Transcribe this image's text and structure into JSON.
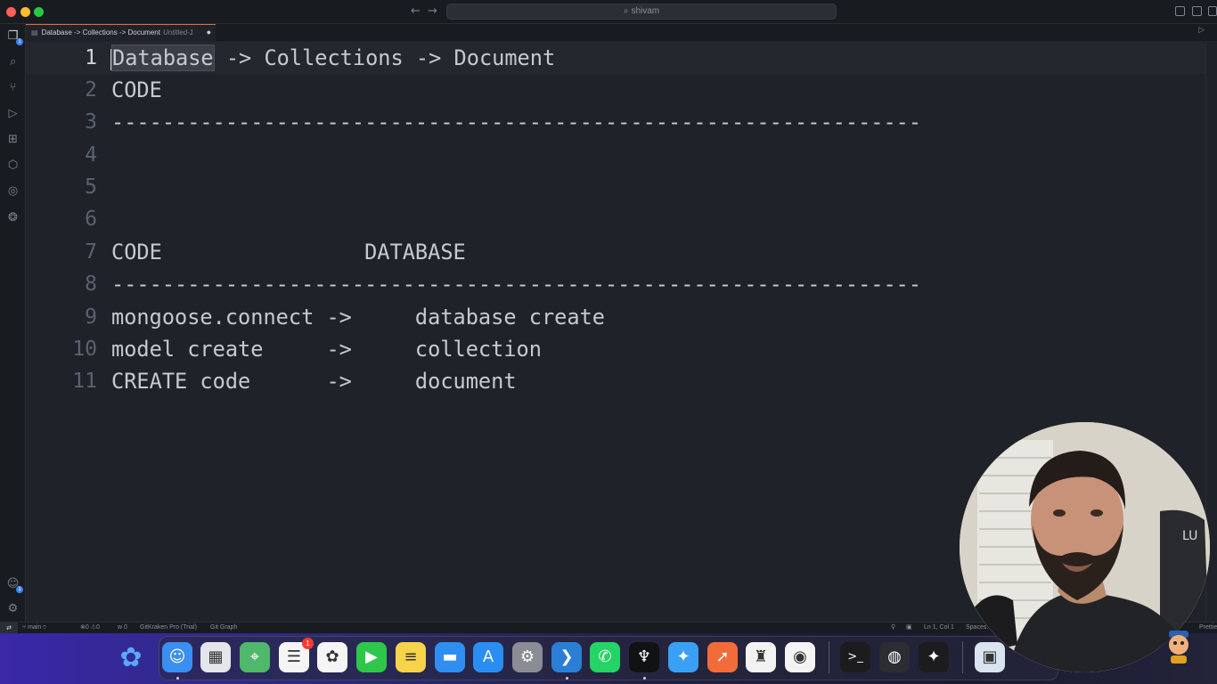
{
  "window": {
    "search_text": "shivam",
    "search_icon": "search-icon",
    "nav_back_icon": "arrow-left-icon",
    "nav_forward_icon": "arrow-right-icon"
  },
  "activity_bar": {
    "items": [
      "files-icon",
      "search-icon",
      "source-control-icon",
      "run-debug-icon",
      "extensions-icon",
      "remote-explorer-icon",
      "gitlens-icon",
      "gitkraken-icon"
    ],
    "bottom": [
      "accounts-icon",
      "settings-gear-icon"
    ],
    "badge": "1"
  },
  "tab": {
    "title": "Database -> Collections -> Document",
    "description": "Untitled-1",
    "modified_indicator": "●"
  },
  "editor": {
    "lines": [
      {
        "number": "1",
        "selected": "Database",
        "text": " -> Collections -> Document"
      },
      {
        "number": "2",
        "text": "CODE"
      },
      {
        "number": "3",
        "text": "----------------------------------------------------------------"
      },
      {
        "number": "4",
        "text": ""
      },
      {
        "number": "5",
        "text": ""
      },
      {
        "number": "6",
        "text": ""
      },
      {
        "number": "7",
        "text": "CODE                DATABASE"
      },
      {
        "number": "8",
        "text": "----------------------------------------------------------------"
      },
      {
        "number": "9",
        "text": "mongoose.connect ->     database create"
      },
      {
        "number": "10",
        "text": "model create     ->     collection"
      },
      {
        "number": "11",
        "text": "CREATE code      ->     document"
      }
    ]
  },
  "status_bar": {
    "branch": "main",
    "problems": "0",
    "warnings": "0",
    "ports": "0",
    "gitkraken": "GitKraken Pro (Trial)",
    "git_graph": "Git Graph",
    "position": "Ln 1, Col 1",
    "spaces": "Spaces:",
    "prettier": "Prettie"
  },
  "dock": {
    "apps": [
      {
        "name": "finder-icon",
        "glyph": "☺",
        "color": "#3b8ff0"
      },
      {
        "name": "launchpad-icon",
        "glyph": "▦",
        "color": "#e4e6eb"
      },
      {
        "name": "maps-icon",
        "glyph": "⌖",
        "color": "#4fb86b"
      },
      {
        "name": "reminders-icon",
        "glyph": "☰",
        "color": "#f5f5f5",
        "badge": "1"
      },
      {
        "name": "photos-icon",
        "glyph": "✿",
        "color": "#f5f5f5"
      },
      {
        "name": "facetime-icon",
        "glyph": "▶",
        "color": "#2fc74b"
      },
      {
        "name": "notes-icon",
        "glyph": "≡",
        "color": "#f7d34a"
      },
      {
        "name": "keynote-icon",
        "glyph": "▬",
        "color": "#2f8ef0"
      },
      {
        "name": "app-store-icon",
        "glyph": "A",
        "color": "#2b8df2"
      },
      {
        "name": "system-settings-icon",
        "glyph": "⚙",
        "color": "#8a8d93"
      },
      {
        "name": "vscode-icon",
        "glyph": "❯",
        "color": "#2a7fd4"
      },
      {
        "name": "whatsapp-icon",
        "glyph": "✆",
        "color": "#25d366"
      },
      {
        "name": "gitkraken-app-icon",
        "glyph": "♆",
        "color": "#111214"
      },
      {
        "name": "safari-icon",
        "glyph": "✦",
        "color": "#3aa0f5"
      },
      {
        "name": "postman-icon",
        "glyph": "➚",
        "color": "#f26b3a"
      },
      {
        "name": "brave-icon",
        "glyph": "♜",
        "color": "#f2f2f2"
      },
      {
        "name": "chrome-icon",
        "glyph": "◉",
        "color": "#f4f4f4"
      },
      {
        "name": "terminal-icon",
        "glyph": ">_",
        "color": "#1c1c1e"
      },
      {
        "name": "obs-icon",
        "glyph": "◍",
        "color": "#2b2d33"
      },
      {
        "name": "figma-icon",
        "glyph": "✦",
        "color": "#1c1c1e"
      },
      {
        "name": "preview-icon",
        "glyph": "▣",
        "color": "#d9e4f0"
      }
    ]
  },
  "colors": {
    "editor_bg": "#1f2329",
    "sidebar_bg": "#181b20",
    "text": "#c5cad2",
    "line_number": "#5a6270",
    "accent": "#e06c3a"
  }
}
